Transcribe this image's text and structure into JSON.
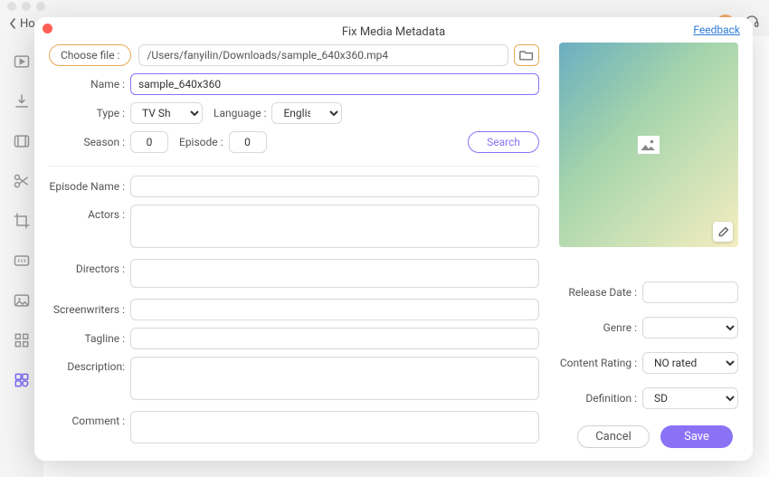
{
  "app": {
    "back_label": "Ho",
    "modal_title": "Fix Media Metadata",
    "feedback": "Feedback"
  },
  "file": {
    "choose_label": "Choose file :",
    "path": "/Users/fanyilin/Downloads/sample_640x360.mp4"
  },
  "labels": {
    "name": "Name :",
    "type": "Type :",
    "language": "Language :",
    "season": "Season :",
    "episode": "Episode :",
    "search": "Search",
    "episode_name": "Episode Name :",
    "actors": "Actors :",
    "directors": "Directors :",
    "screenwriters": "Screenwriters :",
    "tagline": "Tagline :",
    "description": "Description:",
    "comment": "Comment :",
    "release_date": "Release Date :",
    "genre": "Genre :",
    "content_rating": "Content Rating :",
    "definition": "Definition :",
    "cancel": "Cancel",
    "save": "Save"
  },
  "values": {
    "name": "sample_640x360",
    "type": "TV Shows",
    "language": "English",
    "season": "0",
    "episode": "0",
    "episode_name": "",
    "actors": "",
    "directors": "",
    "screenwriters": "",
    "tagline": "",
    "description": "",
    "comment": "",
    "release_date": "",
    "genre": "",
    "content_rating": "NO rated",
    "definition": "SD"
  }
}
